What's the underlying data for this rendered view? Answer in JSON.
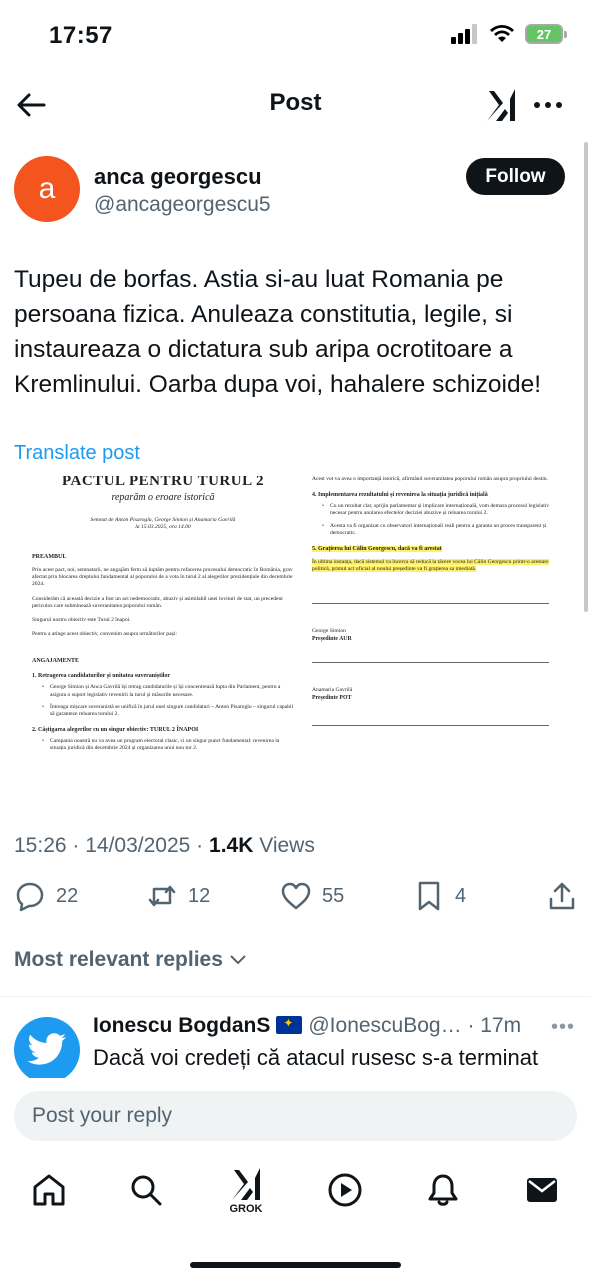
{
  "status_bar": {
    "time": "17:57",
    "battery": "27"
  },
  "nav": {
    "title": "Post"
  },
  "author": {
    "avatar_letter": "a",
    "name": "anca georgescu",
    "handle": "@ancageorgescu5",
    "follow_label": "Follow"
  },
  "tweet": {
    "text": "Tupeu de borfas. Astia si-au luat Romania pe persoana fizica. Anuleaza constitutia, legile, si instaureaza o dictatura sub aripa ocrotitoare a Kremlinului. Oarba dupa voi, hahalere schizoide!",
    "translate_label": "Translate post"
  },
  "document": {
    "title": "PACTUL PENTRU TURUL 2",
    "subtitle": "reparăm o eroare istorică",
    "signed": "Semnat de Anton Pisaroglu, George Simion și Anamaria Gavrilă",
    "date": "la 15.03.2025, ora 14.00",
    "preamble_heading": "PREAMBUL",
    "preamble_p1": "Prin acest pact, noi, semnatarii, ne angajăm ferm să luptăm pentru refacerea procesului democratic în România, grav afectat prin blocarea dreptului fundamental al poporului de a vota în turul 2 al alegerilor prezidențiale din decembrie 2024.",
    "preamble_p2": "Considerăm că această decizie a fost un act nedemocratic, abuziv și asimilabil unei lovituri de stat, un precedent periculos care subminează suveranitatea poporului român.",
    "preamble_p3": "Singurul nostru obiectiv este Turul 2 înapoi.",
    "preamble_p4": "Pentru a atinge acest obiectiv, convenim asupra următorilor pași:",
    "commitments_heading": "ANGAJAMENTE",
    "c1_heading": "1. Retragerea candidaturilor și unitatea suveraniștilor",
    "c1_b1": "George Simion și Anca Gavrilă își retrag candidaturile și își concentrează lupta din Parlament, pentru a asigura o suport legislativ revenirii la turul și măsurile necesare.",
    "c1_b2": "Întreaga mișcare suveranistă se unifică în jurul unei singure candidaturi – Anton Pisaroglu – singurul capabil să garanteze reluarea turului 2.",
    "c2_heading": "2. Câștigarea alegerilor cu un singur obiectiv: TURUL 2 ÎNAPOI",
    "c2_b1": "Campania noastră nu va avea un program electoral clasic, ci un singur punct fundamental: revenirea la situația juridică din decembrie 2024 și organizarea unui nou tur 2.",
    "right_p1": "Acest vot va avea o importanță istorică, afirmând suveranitatea poporului român asupra propriului destin.",
    "c4_heading": "4. Implementarea rezultatului și revenirea la situația juridică inițială",
    "c4_b1": "Cu un rezultat clar, sprijin parlamentar și implicare internațională, vom demara procesul legislativ necesar pentru anularea efectelor deciziei abuzive și reluarea turului 2.",
    "c4_b2": "Acesta va fi organizat cu observatori internaționali reali pentru a garanta un proces transparent și democratic.",
    "c5_heading": "5. Grațierea lui Călin Georgescu, dacă va fi arestat",
    "c5_p": "În ultima instanța, dacă sistemul va încerca să reducă la tăcere vocea lui Călin Georgescu printr-o arestare politică, primul act oficial al noului președinte va fi grațierea sa imediată.",
    "sig1_name": "George Simion",
    "sig1_role": "Președinte AUR",
    "sig2_name": "Anamaria Gavrilă",
    "sig2_role": "Președinte POT"
  },
  "meta": {
    "time": "15:26",
    "sep1": " · ",
    "date": "14/03/2025",
    "sep2": " · ",
    "views_count": "1.4K",
    "views_label": " Views"
  },
  "actions": {
    "replies": "22",
    "reposts": "12",
    "likes": "55",
    "bookmarks": "4"
  },
  "replies_filter": "Most relevant replies",
  "reply": {
    "name": "Ionescu BogdanS",
    "handle": "@IonescuBog…",
    "time": "· 17m",
    "text": "Dacă voi credeți că atacul rusesc s-a terminat"
  },
  "composer": {
    "placeholder": "Post your reply"
  },
  "bottom_nav": {
    "grok_label": "GROK"
  }
}
